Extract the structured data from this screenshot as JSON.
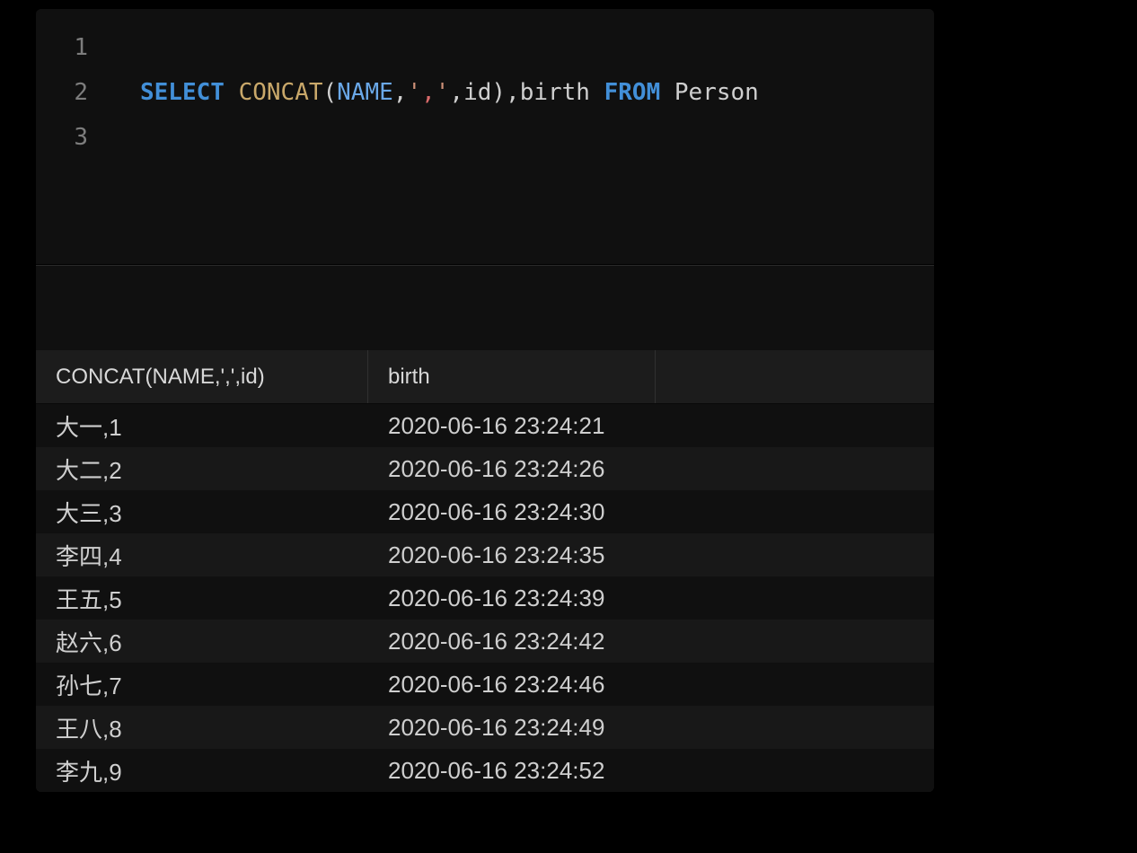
{
  "editor": {
    "lines": [
      "1",
      "2",
      "3"
    ],
    "tokens": {
      "select": "SELECT",
      "concat": "CONCAT",
      "lp": "(",
      "name": "NAME",
      "c1": ",",
      "q1": "'",
      "comma_str": ",",
      "q2": "'",
      "c2": ",",
      "id_arg": "id",
      "rp": ")",
      "c3": ",",
      "birth": "birth",
      "from": "FROM",
      "person": "Person"
    }
  },
  "results": {
    "headers": {
      "col1": "CONCAT(NAME,',',id)",
      "col2": "birth"
    },
    "rows": [
      {
        "col1": "大一,1",
        "col2": "2020-06-16 23:24:21"
      },
      {
        "col1": "大二,2",
        "col2": "2020-06-16 23:24:26"
      },
      {
        "col1": "大三,3",
        "col2": "2020-06-16 23:24:30"
      },
      {
        "col1": "李四,4",
        "col2": "2020-06-16 23:24:35"
      },
      {
        "col1": "王五,5",
        "col2": "2020-06-16 23:24:39"
      },
      {
        "col1": "赵六,6",
        "col2": "2020-06-16 23:24:42"
      },
      {
        "col1": "孙七,7",
        "col2": "2020-06-16 23:24:46"
      },
      {
        "col1": "王八,8",
        "col2": "2020-06-16 23:24:49"
      },
      {
        "col1": "李九,9",
        "col2": "2020-06-16 23:24:52"
      }
    ]
  }
}
